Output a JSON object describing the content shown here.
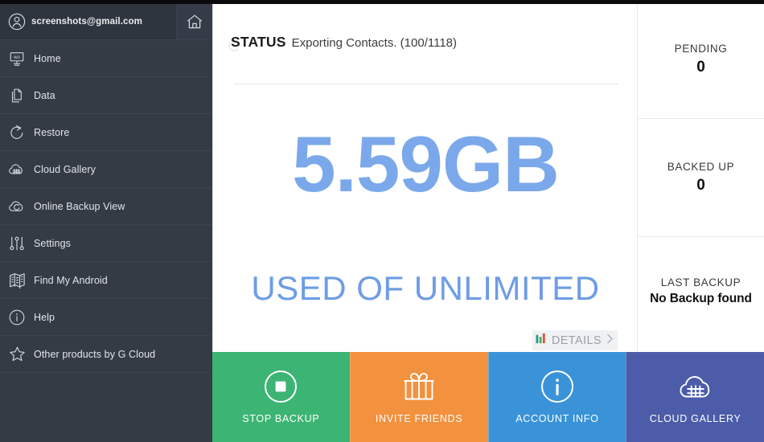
{
  "sidebar": {
    "account": {
      "email": "screenshots@gmail.com",
      "avatar_icon": "user-avatar-icon",
      "home_icon": "home-icon"
    },
    "items": [
      {
        "label": "Home",
        "icon": "monitor-wo-icon"
      },
      {
        "label": "Data",
        "icon": "documents-icon"
      },
      {
        "label": "Restore",
        "icon": "restore-arrow-icon"
      },
      {
        "label": "Cloud Gallery",
        "icon": "cloud-gallery-icon"
      },
      {
        "label": "Online Backup View",
        "icon": "cloud-check-icon"
      },
      {
        "label": "Settings",
        "icon": "sliders-icon"
      },
      {
        "label": "Find My Android",
        "icon": "map-icon"
      },
      {
        "label": "Help",
        "icon": "info-circle-icon"
      },
      {
        "label": "Other products by G Cloud",
        "icon": "star-icon"
      }
    ]
  },
  "main": {
    "status_label": "STATUS",
    "status_text": "Exporting Contacts. (100/1118)",
    "spinner_icon": "spinner-icon",
    "usage_value": "5.59GB",
    "usage_subtitle": "USED OF UNLIMITED",
    "details_label": "DETAILS",
    "details_icon": "bar-chart-icon",
    "details_chevron": "chevron-right-icon",
    "usage_color": "#7ba8ea",
    "usage_sub_color": "#6e9de4"
  },
  "stats": [
    {
      "title": "PENDING",
      "value": "0"
    },
    {
      "title": "BACKED UP",
      "value": "0"
    },
    {
      "title": "LAST BACKUP",
      "value": "No Backup found"
    }
  ],
  "actions": [
    {
      "label": "STOP BACKUP",
      "icon": "stop-circle-icon",
      "color": "#3cb473"
    },
    {
      "label": "INVITE FRIENDS",
      "icon": "gift-icon",
      "color": "#f2913e"
    },
    {
      "label": "ACCOUNT INFO",
      "icon": "info-circle-icon",
      "color": "#3a93d8"
    },
    {
      "label": "CLOUD GALLERY",
      "icon": "cloud-grid-icon",
      "color": "#4c5ca8"
    }
  ]
}
